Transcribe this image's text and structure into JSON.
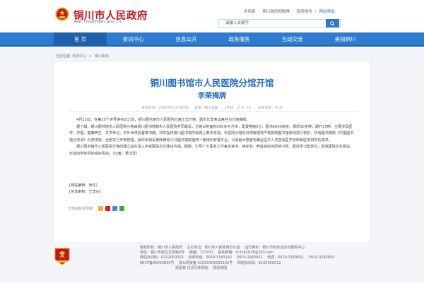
{
  "header": {
    "site_title": "铜川市人民政府",
    "site_url": "www.tongchuan.gov.cn",
    "top_links": [
      "手机版",
      "铜川政府网微博",
      "政府微信",
      "网站导航"
    ],
    "search_placeholder": "请输入关键字"
  },
  "nav": {
    "items": [
      "首 页",
      "资讯中心",
      "信息公开",
      "政务服务",
      "互动交流",
      "美丽铜川"
    ]
  },
  "breadcrumb": {
    "label": "当前位置:",
    "items": [
      "资讯中心",
      "铜川新闻"
    ]
  },
  "article": {
    "title": "铜川图书馆市人民医院分馆开馆",
    "subtitle": "李荣揭牌",
    "meta": {
      "date": "发布时间：2020-04-24 08:55",
      "source": "来源：铜川日报",
      "font_size": "【字体：大 中 小】",
      "views": "浏览次数：41次"
    },
    "paragraphs": [
      "4月23日，在第25个世界读书日之际，铜川图书馆市人民医院分馆正式开馆，副市长李荣出席并为分馆揭牌。",
      "据了解，铜川图书馆市人民医院分馆由铜川图书馆和市人民医院共同建设，分馆占地面积200多平方米，配置电脑5台，图书5000余册，报纸30多种，期刊25种，主要涉及医学、护理、健康养生、文学传记、中外世界名著等书籍。同时提供铜川图书馆所有网上数字资源。市医院分馆的日常管理将严格按照图书馆条例进行管护，所有图书按照《中国图书馆分类法》分类排架，全部实行开架管理，操作系统采用陕西省公共图书馆联盟统一使用的管理平台，以便最大限度地满足医护人员查阅医学资料和医学研究的需求。",
      "铜川图书馆市人民医院分馆的建立旨在深入丰富医院文化建设内涵，鼓励、引导广大医务工作者多读书、读好书，养成良好的阅读习惯，建设学习型单位，促进医院文化建设，形成向学好问的良好风尚。（记者：吴洋武）"
    ],
    "editor": "[网站编辑：张淳]",
    "reviewer": "[信息审核：王李兴]",
    "share_label": "分享给好友阅读："
  },
  "footer": {
    "line1": [
      "版权所有：铜川市人民政府",
      "主办单位：铜川市人民政府办公室",
      "运行维护：铜川市政务信息化服务中心"
    ],
    "line2": [
      "地址：铜川市新区正阳路9号",
      "邮编：727031",
      "联系邮箱：tc3181828@163.com"
    ],
    "line3": [
      "网站标识码：6102000002",
      "咨询电话：0919-3183142",
      "0919-3183922",
      "传真：0919-3183601",
      "0919-3183605"
    ],
    "line4": [
      "陕ICP备05000839号",
      "陕公网安备 61020402000102号",
      "网站标识码：6102000012"
    ],
    "line5": [
      "您是第 位访问本网站",
      "网站地图"
    ]
  },
  "colors": {
    "brand_red": "#c4161c",
    "nav_blue": "#2e7cd0",
    "title_blue": "#1f6bc5"
  }
}
